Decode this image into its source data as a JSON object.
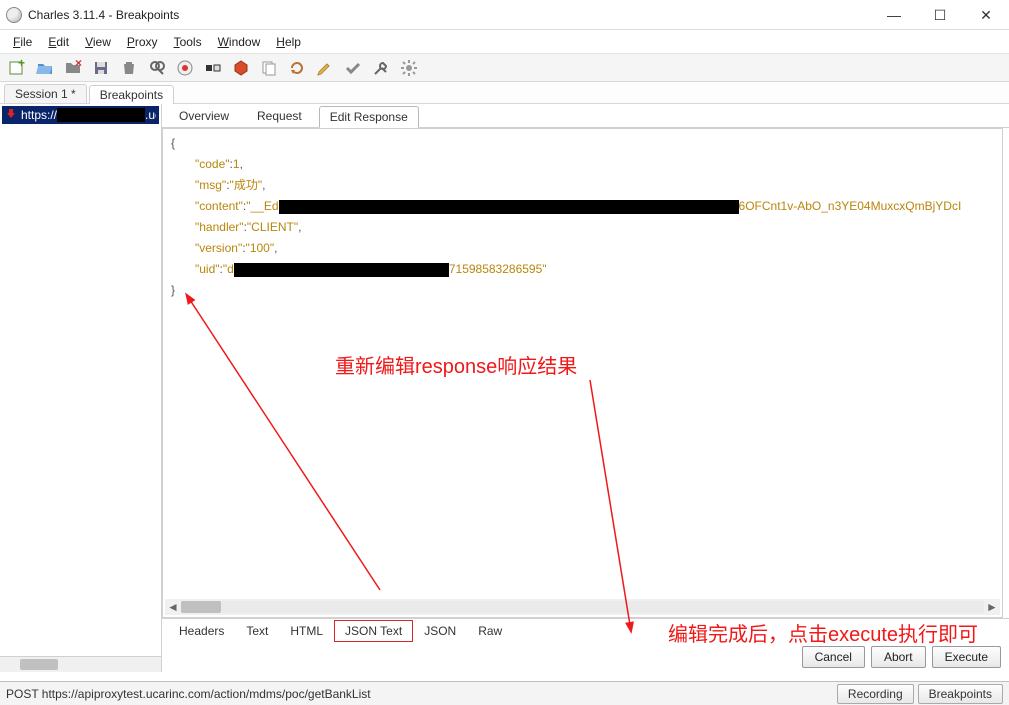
{
  "title": "Charles 3.11.4 - Breakpoints",
  "menu": {
    "file": "File",
    "edit": "Edit",
    "view": "View",
    "proxy": "Proxy",
    "tools": "Tools",
    "window": "Window",
    "help": "Help"
  },
  "session_tabs": [
    "Session 1 *",
    "Breakpoints"
  ],
  "session_active": 1,
  "tree": {
    "item0_label": "https://",
    "item0_suffix": ".uc"
  },
  "view_tabs": [
    "Overview",
    "Request",
    "Edit Response"
  ],
  "view_active": 2,
  "json": {
    "code": 1,
    "msg": "成功",
    "content_prefix": "__Ed",
    "content_suffix": "6OFCnt1v-AbO_n3YE04MuxcxQmBjYDcI",
    "handler": "CLIENT",
    "version": "100",
    "uid_prefix": "d",
    "uid_suffix": "71598583286595"
  },
  "bottom_tabs": [
    "Headers",
    "Text",
    "HTML",
    "JSON Text",
    "JSON",
    "Raw"
  ],
  "bottom_active": 3,
  "actions": {
    "cancel": "Cancel",
    "abort": "Abort",
    "execute": "Execute"
  },
  "annotations": {
    "a1": "重新编辑response响应结果",
    "a2": "编辑完成后，点击execute执行即可"
  },
  "status": {
    "text": "POST https://apiproxytest.ucarinc.com/action/mdms/poc/getBankList",
    "recording": "Recording",
    "breakpoints": "Breakpoints"
  }
}
